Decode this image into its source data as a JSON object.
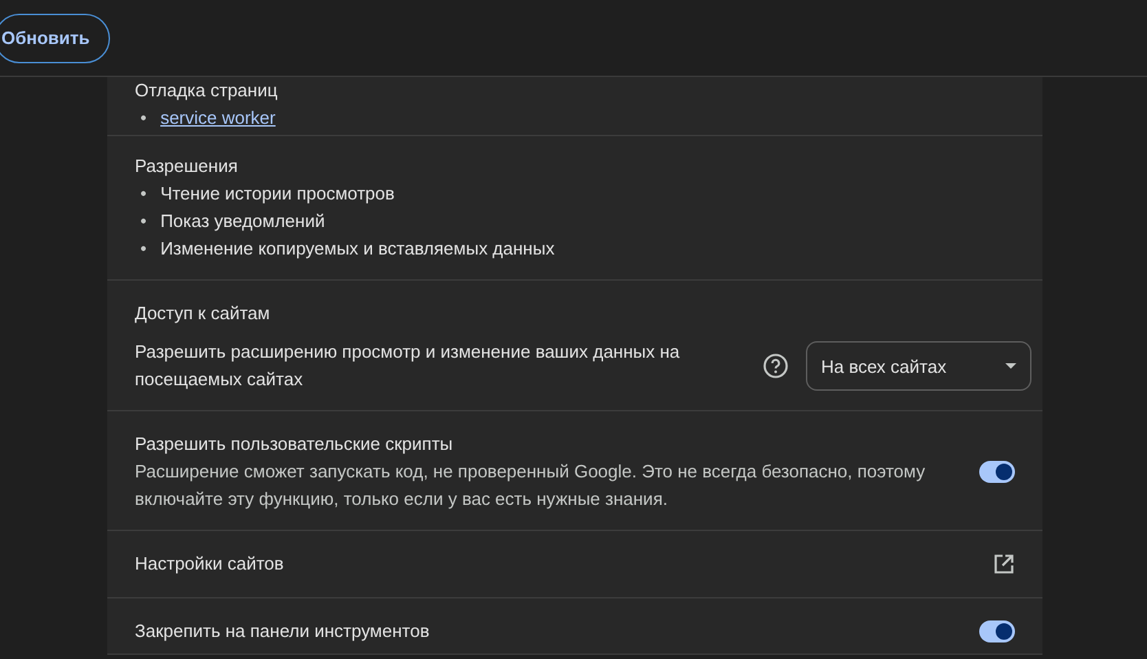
{
  "header": {
    "button": "Обновить"
  },
  "inspect": {
    "title": "Отладка страниц",
    "links": [
      {
        "marker": "•",
        "text": "service worker"
      }
    ]
  },
  "permissions": {
    "title": "Разрешения",
    "items": [
      {
        "marker": "•",
        "text": "Чтение истории просмотров"
      },
      {
        "marker": "•",
        "text": "Показ уведомлений"
      },
      {
        "marker": "•",
        "text": "Изменение копируемых и вставляемых данных"
      }
    ]
  },
  "site_access": {
    "title": "Доступ к сайтам",
    "label": "Разрешить расширению просмотр и изменение ваших данных на посещаемых сайтах",
    "select": "На всех сайтах"
  },
  "rows": [
    {
      "kind": "toggle",
      "title": "Разрешить пользовательские скрипты",
      "description": "Расширение сможет запускать код, не проверенный Google. Это не всегда безопасно, поэтому включайте эту функцию, только если у вас есть нужные знания.",
      "on": true
    },
    {
      "kind": "link",
      "title": "Настройки сайтов"
    },
    {
      "kind": "toggle",
      "title": "Закрепить на панели инструментов",
      "on": true
    }
  ]
}
